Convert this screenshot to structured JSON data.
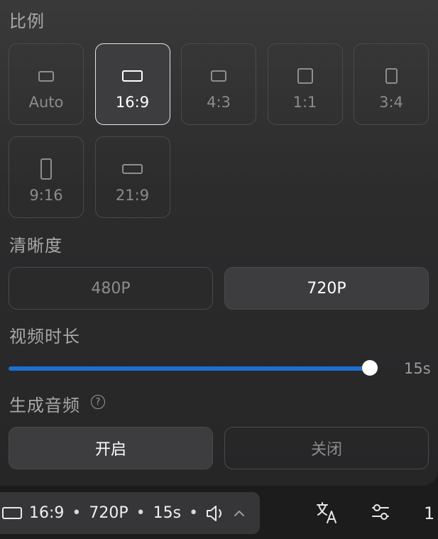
{
  "sections": {
    "ratio_title": "比例",
    "resolution_title": "清晰度",
    "duration_title": "视频时长",
    "audio_title": "生成音频"
  },
  "ratios": [
    {
      "label": "Auto",
      "selected": false
    },
    {
      "label": "16:9",
      "selected": true
    },
    {
      "label": "4:3",
      "selected": false
    },
    {
      "label": "1:1",
      "selected": false
    },
    {
      "label": "3:4",
      "selected": false
    },
    {
      "label": "9:16",
      "selected": false
    },
    {
      "label": "21:9",
      "selected": false
    }
  ],
  "resolution": {
    "options": [
      "480P",
      "720P"
    ],
    "selected": "720P"
  },
  "duration": {
    "value_label": "15s",
    "fill_fraction": 1.0,
    "accent_color": "#1e6fd0"
  },
  "audio": {
    "help_symbol": "?",
    "options": [
      "开启",
      "关闭"
    ],
    "selected": "开启"
  },
  "bottom_bar": {
    "ratio": "16:9",
    "resolution": "720P",
    "duration": "15s",
    "separator": "•",
    "icons": [
      "aspect-ratio-icon",
      "speaker-icon",
      "chevron-up-icon"
    ]
  },
  "toolbar": {
    "icons": [
      "translate-icon",
      "settings-sliders-icon"
    ],
    "cut_text": "1"
  }
}
